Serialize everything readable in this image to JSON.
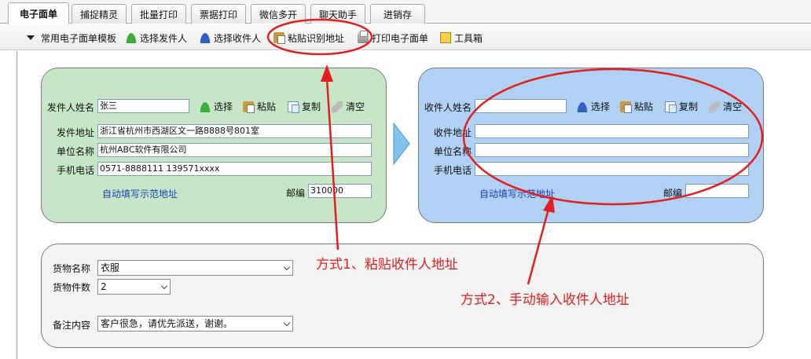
{
  "tabs": [
    {
      "label": "电子面单",
      "active": true
    },
    {
      "label": "捕捉精灵"
    },
    {
      "label": "批量打印"
    },
    {
      "label": "票据打印"
    },
    {
      "label": "微信多开"
    },
    {
      "label": "聊天助手"
    },
    {
      "label": "进销存"
    }
  ],
  "toolbar": {
    "templates": "常用电子面单模板",
    "select_sender": "选择发件人",
    "select_receiver": "选择收件人",
    "paste_address": "粘贴识别地址",
    "print": "打印电子面单",
    "toolbox": "工具箱"
  },
  "sender": {
    "name_label": "发件人姓名",
    "name_value": "张三",
    "select": "选择",
    "paste": "粘贴",
    "copy": "复制",
    "clear": "清空",
    "address_label": "发件地址",
    "address_value": "浙江省杭州市西湖区文一路8888号801室",
    "company_label": "单位名称",
    "company_value": "杭州ABC软件有限公司",
    "phone_label": "手机电话",
    "phone_value": "0571-8888111 139571xxxx",
    "autofill_link": "自动填写示范地址",
    "zip_label": "邮编",
    "zip_value": "310000"
  },
  "receiver": {
    "name_label": "收件人姓名",
    "name_value": "",
    "select": "选择",
    "paste": "粘贴",
    "copy": "复制",
    "clear": "清空",
    "address_label": "收件地址",
    "address_value": "",
    "company_label": "单位名称",
    "company_value": "",
    "phone_label": "手机电话",
    "phone_value": "",
    "autofill_link": "自动填写示范地址",
    "zip_label": "邮编",
    "zip_value": ""
  },
  "goods": {
    "name_label": "货物名称",
    "name_value": "衣服",
    "count_label": "货物件数",
    "count_value": "2",
    "remark_label": "备注内容",
    "remark_value": "客户很急，请优先派送，谢谢。"
  },
  "annotations": {
    "method1": "方式1、粘贴收件人地址",
    "method2": "方式2、手动输入收件人地址"
  },
  "colors": {
    "sender_panel": "#c7e6c7",
    "receiver_panel": "#b0d0f4",
    "annotation_red": "#e02020",
    "link_blue": "#1a3fb0"
  }
}
